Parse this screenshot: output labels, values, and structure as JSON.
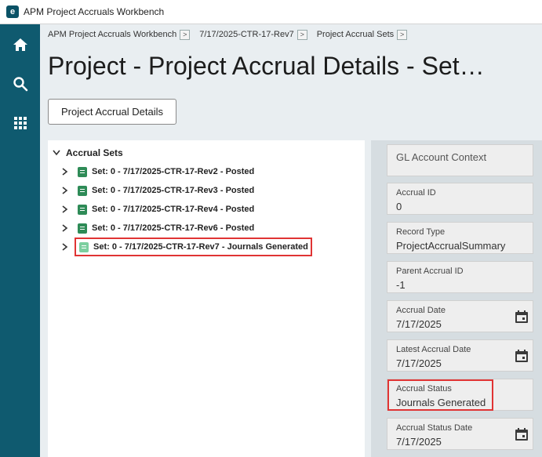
{
  "window": {
    "title": "APM Project Accruals Workbench",
    "logo_letter": "e"
  },
  "nav": {
    "items": [
      {
        "name": "home",
        "icon": "home-icon"
      },
      {
        "name": "search",
        "icon": "search-icon"
      },
      {
        "name": "apps",
        "icon": "grid-icon"
      }
    ]
  },
  "breadcrumb": {
    "items": [
      "APM Project Accruals Workbench",
      "7/17/2025-CTR-17-Rev7",
      "Project Accrual Sets"
    ],
    "separator": ">"
  },
  "page": {
    "title": "Project - Project Accrual Details - Set…",
    "primary_button": "Project Accrual Details"
  },
  "tree": {
    "root_label": "Accrual Sets",
    "items": [
      "Set: 0 - 7/17/2025-CTR-17-Rev2 - Posted",
      "Set: 0 - 7/17/2025-CTR-17-Rev3 - Posted",
      "Set: 0 - 7/17/2025-CTR-17-Rev4 - Posted",
      "Set: 0 - 7/17/2025-CTR-17-Rev6 - Posted",
      "Set: 0 - 7/17/2025-CTR-17-Rev7 - Journals Generated"
    ]
  },
  "form": {
    "gl_account_context": "GL Account Context",
    "fields": [
      {
        "label": "Accrual ID",
        "value": "0"
      },
      {
        "label": "Record Type",
        "value": "ProjectAccrualSummary"
      },
      {
        "label": "Parent Accrual ID",
        "value": "-1"
      },
      {
        "label": "Accrual Date",
        "value": "7/17/2025"
      },
      {
        "label": "Latest Accrual Date",
        "value": "7/17/2025"
      },
      {
        "label": "Accrual Status",
        "value": "Journals Generated"
      },
      {
        "label": "Accrual Status Date",
        "value": "7/17/2025"
      }
    ]
  },
  "colors": {
    "nav_bg": "#0f5a6f",
    "highlight": "#e03434",
    "set_icon": "#2e8b57"
  }
}
